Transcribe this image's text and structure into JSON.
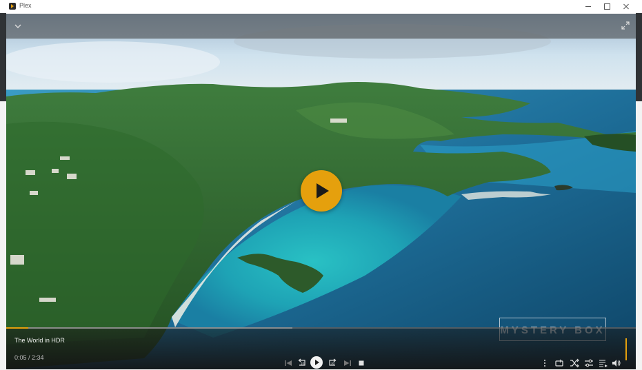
{
  "window": {
    "app_title": "Plex"
  },
  "player": {
    "media_title": "The World in HDR",
    "time_display": "0:05 / 2:34",
    "progress_fraction": 0.035,
    "buffered_fraction": 0.455,
    "watermark_text": "MYSTERY BOX",
    "accent_color": "#e5a00d"
  },
  "icons": {
    "collapse": "chevron-down-icon",
    "fullscreen": "expand-icon",
    "big_play": "play-icon",
    "skip_previous": "skip-previous-icon",
    "replay": "replay-10-icon",
    "play": "play-icon",
    "forward": "forward-30-icon",
    "skip_next": "skip-next-icon",
    "stop": "stop-icon",
    "more": "more-vertical-icon",
    "repeat": "repeat-icon",
    "shuffle": "shuffle-icon",
    "settings": "sliders-icon",
    "queue": "playlist-icon",
    "volume": "volume-icon"
  }
}
